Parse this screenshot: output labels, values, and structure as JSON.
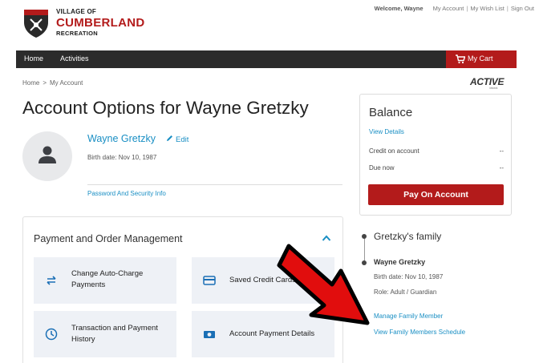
{
  "brand": {
    "line1": "VILLAGE OF",
    "line2": "CUMBERLAND",
    "line3": "RECREATION",
    "badge_text": "CUMBERLAND",
    "accent": "#b31b1b"
  },
  "top_links": {
    "welcome": "Welcome, Wayne",
    "account": "My Account",
    "wishlist": "My Wish List",
    "signout": "Sign Out"
  },
  "nav": {
    "home": "Home",
    "activities": "Activities",
    "cart": "My Cart",
    "cart_icon": "shopping-cart-icon"
  },
  "breadcrumb": {
    "home": "Home",
    "separator": ">",
    "current": "My Account"
  },
  "active_logo": {
    "text": "ACTIVE",
    "sub": "network"
  },
  "page": {
    "title": "Account Options for Wayne Gretzky"
  },
  "profile": {
    "name": "Wayne Gretzky",
    "edit": "Edit",
    "birth": "Birth date: Nov 10, 1987",
    "password_link": "Password And Security Info"
  },
  "payment": {
    "title": "Payment and Order Management",
    "tiles": [
      {
        "label": "Change Auto-Charge Payments",
        "icon": "swap-arrows-icon"
      },
      {
        "label": "Saved Credit Cards",
        "icon": "credit-card-icon"
      },
      {
        "label": "Transaction and Payment History",
        "icon": "clock-icon"
      },
      {
        "label": "Account Payment Details",
        "icon": "money-icon"
      }
    ]
  },
  "balance": {
    "title": "Balance",
    "details_link": "View Details",
    "rows": [
      {
        "label": "Credit on account",
        "value": "--"
      },
      {
        "label": "Due now",
        "value": "--"
      }
    ],
    "pay_button": "Pay On Account"
  },
  "family": {
    "title": "Gretzky's family",
    "member_name": "Wayne Gretzky",
    "member_birth": "Birth date: Nov 10, 1987",
    "member_role": "Role: Adult / Guardian",
    "manage_link": "Manage Family Member",
    "schedule_link": "View Family Members Schedule"
  }
}
